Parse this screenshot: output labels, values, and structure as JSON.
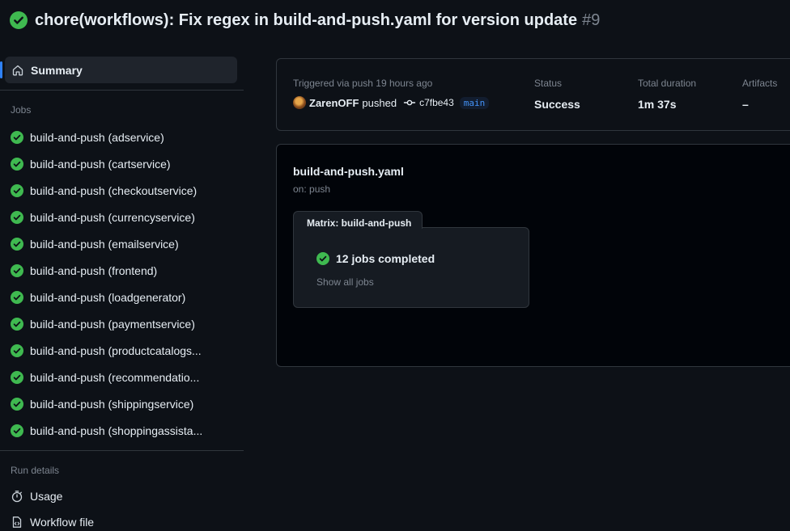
{
  "header": {
    "title": "chore(workflows): Fix regex in build-and-push.yaml for version update",
    "run_number": "#9"
  },
  "sidebar": {
    "summary_label": "Summary",
    "jobs_label": "Jobs",
    "jobs": [
      {
        "label": "build-and-push (adservice)"
      },
      {
        "label": "build-and-push (cartservice)"
      },
      {
        "label": "build-and-push (checkoutservice)"
      },
      {
        "label": "build-and-push (currencyservice)"
      },
      {
        "label": "build-and-push (emailservice)"
      },
      {
        "label": "build-and-push (frontend)"
      },
      {
        "label": "build-and-push (loadgenerator)"
      },
      {
        "label": "build-and-push (paymentservice)"
      },
      {
        "label": "build-and-push (productcatalogs..."
      },
      {
        "label": "build-and-push (recommendatio..."
      },
      {
        "label": "build-and-push (shippingservice)"
      },
      {
        "label": "build-and-push (shoppingassista..."
      }
    ],
    "run_details_label": "Run details",
    "usage_label": "Usage",
    "workflow_file_label": "Workflow file"
  },
  "summary_card": {
    "trigger_text": "Triggered via push 19 hours ago",
    "actor": "ZarenOFF",
    "action": "pushed",
    "commit_sha": "c7fbe43",
    "branch": "main",
    "status_label": "Status",
    "status_value": "Success",
    "duration_label": "Total duration",
    "duration_value": "1m 37s",
    "artifacts_label": "Artifacts",
    "artifacts_value": "–"
  },
  "workflow_graph": {
    "workflow_name": "build-and-push.yaml",
    "trigger": "on: push",
    "matrix_title": "Matrix: build-and-push",
    "matrix_status": "12 jobs completed",
    "show_all_label": "Show all jobs"
  },
  "colors": {
    "success": "#3fb950",
    "accent": "#2f81f7",
    "background": "#0d1117"
  },
  "icons": {
    "status": "check-circle-fill-icon",
    "summary": "home-icon",
    "commit": "git-commit-icon",
    "usage": "stopwatch-icon",
    "workflow_file": "file-code-icon"
  }
}
